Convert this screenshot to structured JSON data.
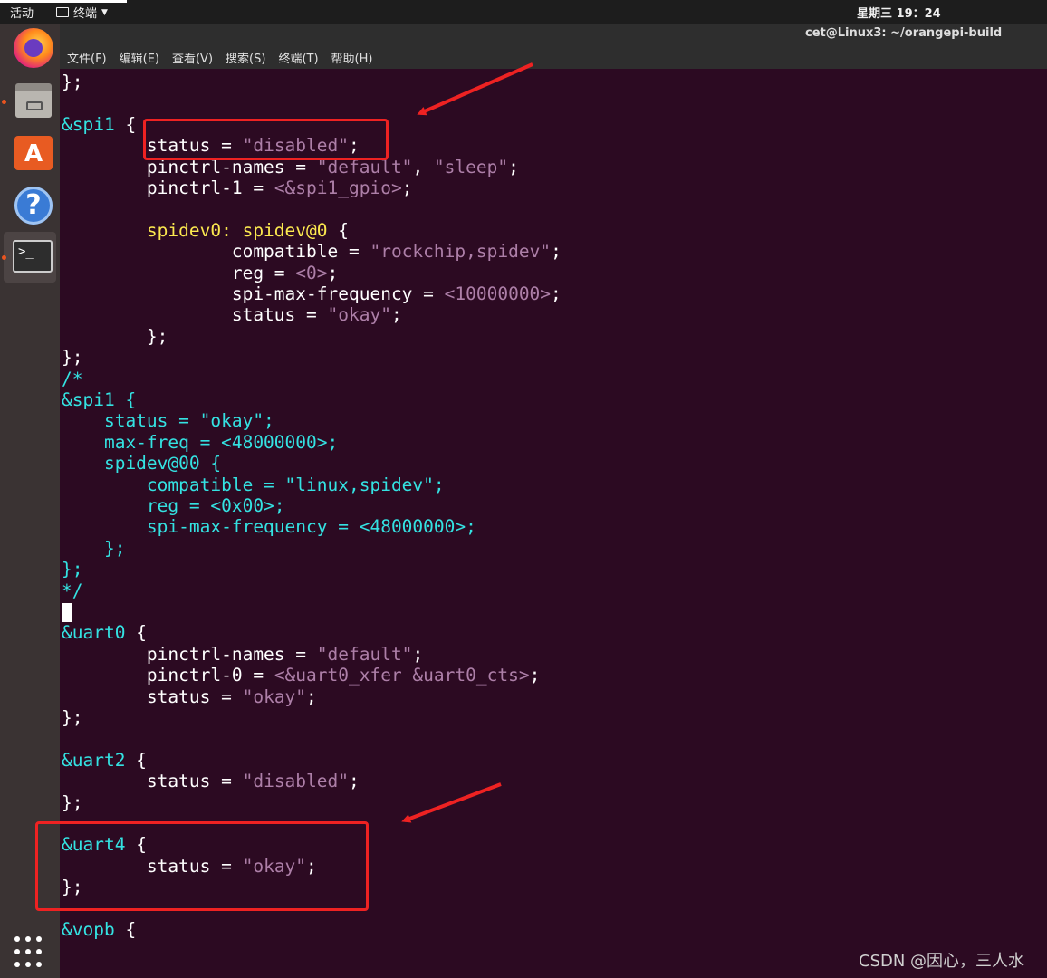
{
  "topbar": {
    "activities": "活动",
    "app_menu": "终端",
    "clock": "星期三 19：24"
  },
  "window": {
    "title": "cet@Linux3: ~/orangepi-build"
  },
  "menubar": {
    "items": [
      "文件(F)",
      "编辑(E)",
      "查看(V)",
      "搜索(S)",
      "终端(T)",
      "帮助(H)"
    ]
  },
  "dock": {
    "items": [
      "firefox-icon",
      "files-icon",
      "software-icon",
      "help-icon",
      "terminal-icon",
      "show-apps-icon"
    ]
  },
  "terminal": {
    "lines": [
      [
        {
          "t": "};",
          "c": "def"
        }
      ],
      [],
      [
        {
          "t": "&spi1",
          "c": "cyan"
        },
        {
          "t": " {",
          "c": "def"
        }
      ],
      [
        {
          "t": "        status = ",
          "c": "def"
        },
        {
          "t": "\"disabled\"",
          "c": "str"
        },
        {
          "t": ";",
          "c": "def"
        }
      ],
      [
        {
          "t": "        pinctrl-names = ",
          "c": "def"
        },
        {
          "t": "\"default\"",
          "c": "str"
        },
        {
          "t": ", ",
          "c": "def"
        },
        {
          "t": "\"sleep\"",
          "c": "str"
        },
        {
          "t": ";",
          "c": "def"
        }
      ],
      [
        {
          "t": "        pinctrl-1 = ",
          "c": "def"
        },
        {
          "t": "<&spi1_gpio>",
          "c": "str"
        },
        {
          "t": ";",
          "c": "def"
        }
      ],
      [],
      [
        {
          "t": "        spidev0: spidev@0",
          "c": "yellow"
        },
        {
          "t": " {",
          "c": "def"
        }
      ],
      [
        {
          "t": "                compatible = ",
          "c": "def"
        },
        {
          "t": "\"rockchip,spidev\"",
          "c": "str"
        },
        {
          "t": ";",
          "c": "def"
        }
      ],
      [
        {
          "t": "                reg = ",
          "c": "def"
        },
        {
          "t": "<0>",
          "c": "str"
        },
        {
          "t": ";",
          "c": "def"
        }
      ],
      [
        {
          "t": "                spi-max-frequency = ",
          "c": "def"
        },
        {
          "t": "<10000000>",
          "c": "str"
        },
        {
          "t": ";",
          "c": "def"
        }
      ],
      [
        {
          "t": "                status = ",
          "c": "def"
        },
        {
          "t": "\"okay\"",
          "c": "str"
        },
        {
          "t": ";",
          "c": "def"
        }
      ],
      [
        {
          "t": "        };",
          "c": "def"
        }
      ],
      [
        {
          "t": "};",
          "c": "def"
        }
      ],
      [
        {
          "t": "/*",
          "c": "cyan"
        }
      ],
      [
        {
          "t": "&spi1 {",
          "c": "cyan"
        }
      ],
      [
        {
          "t": "    status = \"okay\";",
          "c": "cyan"
        }
      ],
      [
        {
          "t": "    max-freq = <48000000>;",
          "c": "cyan"
        }
      ],
      [
        {
          "t": "    spidev@00 {",
          "c": "cyan"
        }
      ],
      [
        {
          "t": "        compatible = \"linux,spidev\";",
          "c": "cyan"
        }
      ],
      [
        {
          "t": "        reg = <0x00>;",
          "c": "cyan"
        }
      ],
      [
        {
          "t": "        spi-max-frequency = <48000000>;",
          "c": "cyan"
        }
      ],
      [
        {
          "t": "    };",
          "c": "cyan"
        }
      ],
      [
        {
          "t": "};",
          "c": "cyan"
        }
      ],
      [
        {
          "t": "*/",
          "c": "cyan"
        }
      ],
      [
        {
          "t": "",
          "c": "cursor"
        }
      ],
      [
        {
          "t": "&uart0",
          "c": "cyan"
        },
        {
          "t": " {",
          "c": "def"
        }
      ],
      [
        {
          "t": "        pinctrl-names = ",
          "c": "def"
        },
        {
          "t": "\"default\"",
          "c": "str"
        },
        {
          "t": ";",
          "c": "def"
        }
      ],
      [
        {
          "t": "        pinctrl-0 = ",
          "c": "def"
        },
        {
          "t": "<&uart0_xfer &uart0_cts>",
          "c": "str"
        },
        {
          "t": ";",
          "c": "def"
        }
      ],
      [
        {
          "t": "        status = ",
          "c": "def"
        },
        {
          "t": "\"okay\"",
          "c": "str"
        },
        {
          "t": ";",
          "c": "def"
        }
      ],
      [
        {
          "t": "};",
          "c": "def"
        }
      ],
      [],
      [
        {
          "t": "&uart2",
          "c": "cyan"
        },
        {
          "t": " {",
          "c": "def"
        }
      ],
      [
        {
          "t": "        status = ",
          "c": "def"
        },
        {
          "t": "\"disabled\"",
          "c": "str"
        },
        {
          "t": ";",
          "c": "def"
        }
      ],
      [
        {
          "t": "};",
          "c": "def"
        }
      ],
      [],
      [
        {
          "t": "&uart4",
          "c": "cyan"
        },
        {
          "t": " {",
          "c": "def"
        }
      ],
      [
        {
          "t": "        status = ",
          "c": "def"
        },
        {
          "t": "\"okay\"",
          "c": "str"
        },
        {
          "t": ";",
          "c": "def"
        }
      ],
      [
        {
          "t": "};",
          "c": "def"
        }
      ],
      [],
      [
        {
          "t": "&vopb",
          "c": "cyan"
        },
        {
          "t": " {",
          "c": "def"
        }
      ]
    ]
  },
  "watermark": "CSDN @因心，三人水",
  "colors": {
    "terminal_bg": "#2c0a22",
    "cyan": "#34e2e2",
    "yellow": "#fce94f",
    "string": "#ad7fa8",
    "annotation": "#ee2222"
  }
}
